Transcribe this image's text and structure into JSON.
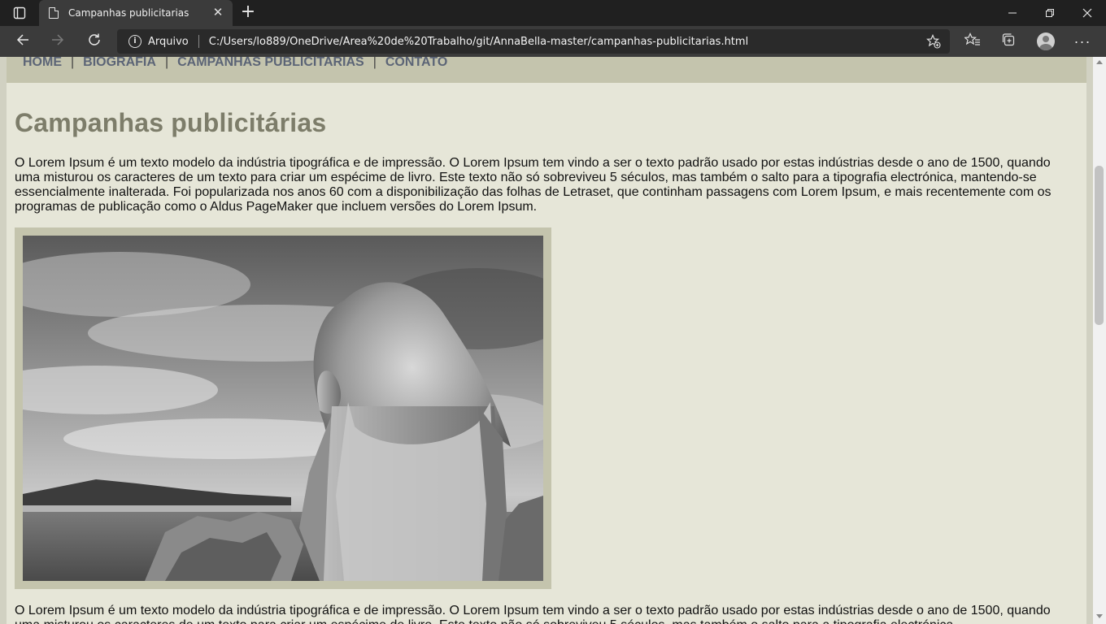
{
  "browser": {
    "tab_title": "Campanhas publicitarias",
    "new_tab": "+",
    "address_label": "Arquivo",
    "url": "C:/Users/lo889/OneDrive/Área%20de%20Trabalho/git/AnnaBella-master/campanhas-publicitarias.html",
    "more_label": "···",
    "close_tab": "✕"
  },
  "icons": {
    "tab_actions": "tab-actions-icon",
    "page": "page-icon",
    "back": "back-arrow-icon",
    "forward": "forward-arrow-icon",
    "reload": "reload-icon",
    "info": "info-icon",
    "add_favorite": "star-plus-icon",
    "favorites": "favorites-icon",
    "collections": "collections-icon",
    "profile": "avatar",
    "more": "more-icon"
  },
  "site_nav": {
    "items": [
      "HOME",
      "BIOGRAFIA",
      "CAMPANHAS PUBLICITARIAS",
      "CONTATO"
    ],
    "separator": "|"
  },
  "page": {
    "title": "Campanhas publicitárias",
    "paragraph_1": "O Lorem Ipsum é um texto modelo da indústria tipográfica e de impressão. O Lorem Ipsum tem vindo a ser o texto padrão usado por estas indústrias desde o ano de 1500, quando uma misturou os caracteres de um texto para criar um espécime de livro. Este texto não só sobreviveu 5 séculos, mas também o salto para a tipografia electrónica, mantendo-se essencialmente inalterada. Foi popularizada nos anos 60 com a disponibilização das folhas de Letraset, que continham passagens com Lorem Ipsum, e mais recentemente com os programas de publicação como o Aldus PageMaker que incluem versões do Lorem Ipsum.",
    "paragraph_2": "O Lorem Ipsum é um texto modelo da indústria tipográfica e de impressão. O Lorem Ipsum tem vindo a ser o texto padrão usado por estas indústrias desde o ano de 1500, quando uma misturou os caracteres de um texto para criar um espécime de livro. Este texto não só sobreviveu 5 séculos, mas também o salto para a tipografia electrónica."
  },
  "colors": {
    "browser_dark": "#202020",
    "toolbar": "#3b3b3b",
    "page_bg": "#e6e6d8",
    "menu_bg": "#c4c4ad",
    "menu_text": "#5b6476",
    "title_text": "#7d7d6a"
  }
}
